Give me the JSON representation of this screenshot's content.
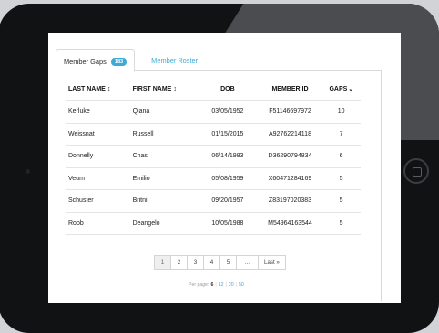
{
  "tabs": {
    "member_gaps": {
      "label": "Member Gaps",
      "badge": "183"
    },
    "member_roster": {
      "label": "Member Roster"
    }
  },
  "table": {
    "headers": {
      "last_name": "LAST NAME",
      "first_name": "FIRST NAME",
      "dob": "DOB",
      "member_id": "MEMBER ID",
      "gaps": "GAPS"
    },
    "rows": [
      {
        "last": "Kerluke",
        "first": "Qiana",
        "dob": "03/05/1952",
        "id": "F51146697972",
        "gaps": "10"
      },
      {
        "last": "Weissnat",
        "first": "Russell",
        "dob": "01/15/2015",
        "id": "A92762214118",
        "gaps": "7"
      },
      {
        "last": "Donnelly",
        "first": "Chas",
        "dob": "06/14/1983",
        "id": "D36290794834",
        "gaps": "6"
      },
      {
        "last": "Veum",
        "first": "Emilio",
        "dob": "05/08/1959",
        "id": "X60471284169",
        "gaps": "5"
      },
      {
        "last": "Schuster",
        "first": "Britni",
        "dob": "09/20/1957",
        "id": "Z83197020383",
        "gaps": "5"
      },
      {
        "last": "Roob",
        "first": "Deangelo",
        "dob": "10/05/1988",
        "id": "M54964163544",
        "gaps": "5"
      }
    ]
  },
  "pagination": {
    "pages": [
      "1",
      "2",
      "3",
      "4",
      "5"
    ],
    "ellipsis": "...",
    "last": "Last »"
  },
  "per_page": {
    "label": "Per page:",
    "options": [
      "6",
      "12",
      "20",
      "50"
    ],
    "separator": "|"
  },
  "icons": {
    "sort": "↕",
    "sort_desc": "⌄"
  },
  "colors": {
    "accent": "#3fa9d6"
  }
}
